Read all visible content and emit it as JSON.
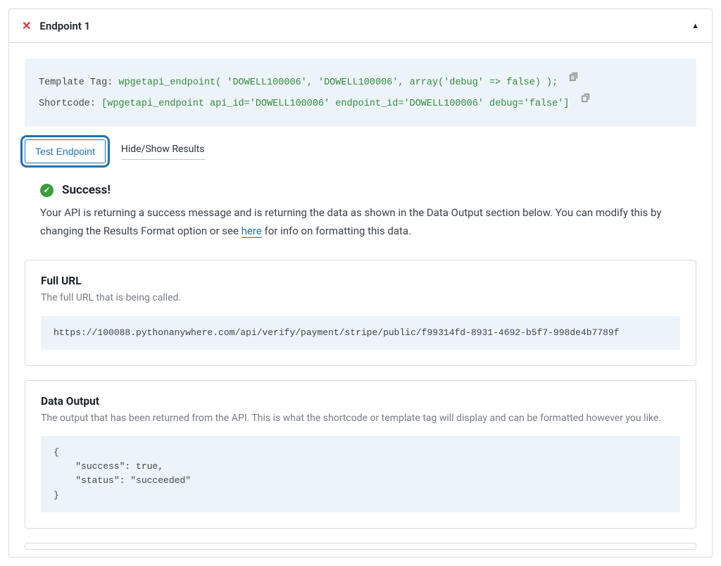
{
  "panel": {
    "title": "Endpoint 1"
  },
  "codebox": {
    "template_tag_label": "Template Tag: ",
    "template_tag_value": "wpgetapi_endpoint( 'DOWELL100006', 'DOWELL100006', array('debug' => false) );",
    "shortcode_label": "Shortcode: ",
    "shortcode_value": "[wpgetapi_endpoint api_id='DOWELL100006' endpoint_id='DOWELL100006' debug='false']"
  },
  "actions": {
    "test_endpoint": "Test Endpoint",
    "toggle_results": "Hide/Show Results"
  },
  "success": {
    "title": "Success!",
    "text_before": "Your API is returning a success message and is returning the data as shown in the Data Output section below. You can modify this by changing the Results Format option or see ",
    "link": "here",
    "text_after": " for info on formatting this data."
  },
  "cards": {
    "url": {
      "title": "Full URL",
      "sub": "The full URL that is being called.",
      "value": "https://100088.pythonanywhere.com/api/verify/payment/stripe/public/f99314fd-8931-4692-b5f7-998de4b7789f"
    },
    "output": {
      "title": "Data Output",
      "sub": "The output that has been returned from the API. This is what the shortcode or template tag will display and can be formatted however you like.",
      "value": "{\n    \"success\": true,\n    \"status\": \"succeeded\"\n}"
    }
  }
}
